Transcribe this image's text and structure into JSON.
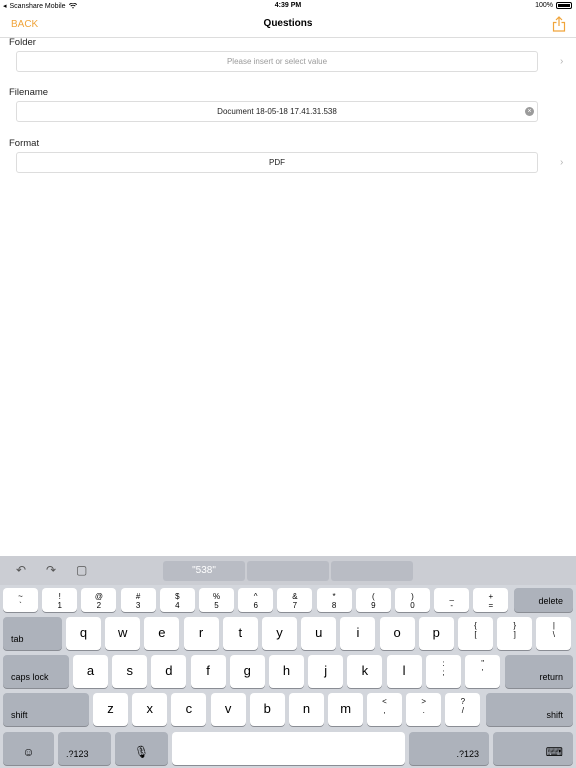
{
  "status": {
    "carrier": "Scanshare Mobile",
    "time": "4:39 PM",
    "battery": "100%"
  },
  "nav": {
    "back": "BACK",
    "title": "Questions"
  },
  "fields": {
    "folder": {
      "label": "Folder",
      "placeholder": "Please insert or select value"
    },
    "filename": {
      "label": "Filename",
      "value": "Document 18-05-18 17.41.31.538"
    },
    "format": {
      "label": "Format",
      "value": "PDF"
    }
  },
  "keyboard": {
    "suggestion": "\"538\"",
    "row1": [
      {
        "top": "~",
        "bot": "`"
      },
      {
        "top": "!",
        "bot": "1"
      },
      {
        "top": "@",
        "bot": "2"
      },
      {
        "top": "#",
        "bot": "3"
      },
      {
        "top": "$",
        "bot": "4"
      },
      {
        "top": "%",
        "bot": "5"
      },
      {
        "top": "^",
        "bot": "6"
      },
      {
        "top": "&",
        "bot": "7"
      },
      {
        "top": "*",
        "bot": "8"
      },
      {
        "top": "(",
        "bot": "9"
      },
      {
        "top": ")",
        "bot": "0"
      },
      {
        "top": "_",
        "bot": "-"
      },
      {
        "top": "+",
        "bot": "="
      }
    ],
    "delete": "delete",
    "tab": "tab",
    "row2": [
      "q",
      "w",
      "e",
      "r",
      "t",
      "y",
      "u",
      "i",
      "o",
      "p"
    ],
    "row2p": [
      {
        "top": "{",
        "bot": "["
      },
      {
        "top": "}",
        "bot": "]"
      },
      {
        "top": "|",
        "bot": "\\"
      }
    ],
    "caps": "caps lock",
    "row3": [
      "a",
      "s",
      "d",
      "f",
      "g",
      "h",
      "j",
      "k",
      "l"
    ],
    "row3p": [
      {
        "top": ":",
        "bot": ";"
      },
      {
        "top": "\"",
        "bot": "'"
      }
    ],
    "return": "return",
    "shift": "shift",
    "row4": [
      "z",
      "x",
      "c",
      "v",
      "b",
      "n",
      "m"
    ],
    "row4p": [
      {
        "top": "<",
        "bot": ","
      },
      {
        "top": ">",
        "bot": "."
      },
      {
        "top": "?",
        "bot": "/"
      }
    ],
    "num": ".?123"
  }
}
